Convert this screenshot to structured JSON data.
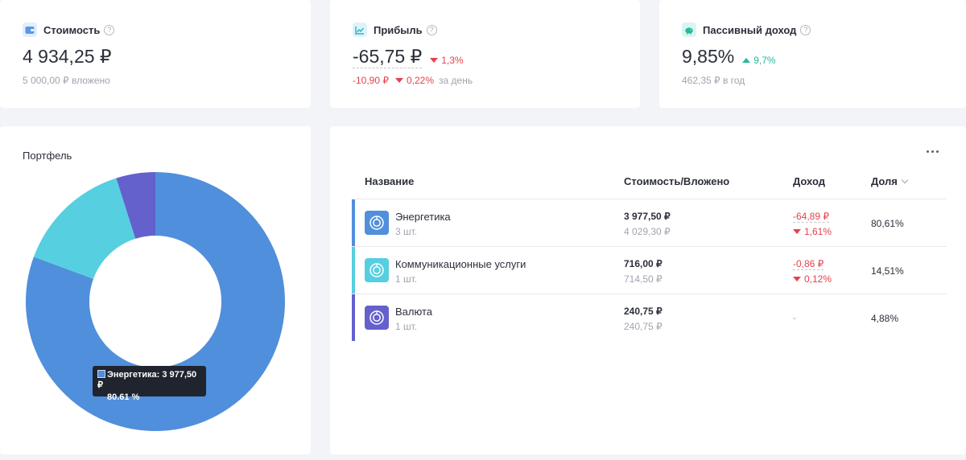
{
  "summary": {
    "cost": {
      "label": "Стоимость",
      "help": "?",
      "value": "4 934,25 ₽",
      "sub": "5 000,00 ₽ вложено",
      "icon": "wallet-icon",
      "icon_color": "#5b97e5",
      "icon_bg": "#e3eefc"
    },
    "profit": {
      "label": "Прибыль",
      "help": "?",
      "value": "-65,75 ₽",
      "delta": "1,3%",
      "day_value": "-10,90 ₽",
      "day_percent": "0,22%",
      "day_label": "за день",
      "icon": "chart-line-icon",
      "icon_color": "#2fb0c8",
      "icon_bg": "#dcf4f8"
    },
    "passive": {
      "label": "Пассивный доход",
      "help": "?",
      "value": "9,85%",
      "delta": "9,7%",
      "sub": "462,35 ₽ в год",
      "icon": "piggy-bank-icon",
      "icon_color": "#27b99b",
      "icon_bg": "#d9f5ef"
    }
  },
  "portfolio": {
    "title": "Портфель",
    "tooltip": {
      "line1": "Энергетика: 3 977,50 ₽",
      "line2": "80.61 %"
    }
  },
  "chart_data": {
    "type": "pie",
    "categories": [
      "Энергетика",
      "Коммуникационные услуги",
      "Валюта"
    ],
    "values": [
      80.61,
      14.51,
      4.88
    ],
    "colors": [
      "#508fdb",
      "#56cfe0",
      "#6460cc"
    ],
    "donut": true
  },
  "table": {
    "more_icon": "more-horizontal-icon",
    "headers": {
      "name": "Название",
      "cost": "Стоимость/Вложено",
      "income": "Доход",
      "share": "Доля"
    },
    "rows": [
      {
        "name": "Энергетика",
        "qty": "3 шт.",
        "cost": "3 977,50 ₽",
        "invested": "4 029,30 ₽",
        "income": "-64,89 ₽",
        "income_pct": "1,61%",
        "share": "80,61%",
        "color": "#508fdb",
        "icon": "sector-icon"
      },
      {
        "name": "Коммуникационные услуги",
        "qty": "1 шт.",
        "cost": "716,00 ₽",
        "invested": "714,50 ₽",
        "income": "-0,86 ₽",
        "income_pct": "0,12%",
        "share": "14,51%",
        "color": "#56cfe0",
        "icon": "sector-icon"
      },
      {
        "name": "Валюта",
        "qty": "1 шт.",
        "cost": "240,75 ₽",
        "invested": "240,75 ₽",
        "income": "-",
        "share": "4,88%",
        "color": "#6460cc",
        "icon": "sector-icon"
      }
    ]
  }
}
